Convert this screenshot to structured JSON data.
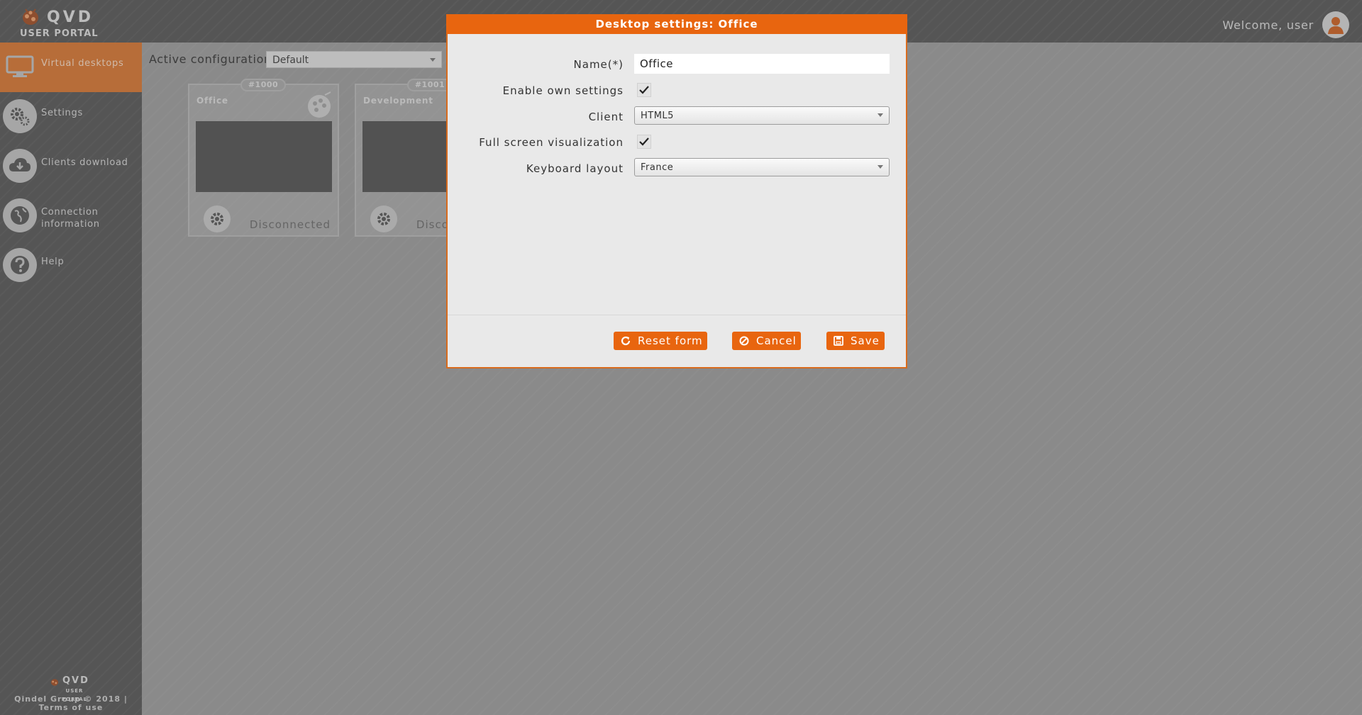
{
  "header": {
    "brand": "QVD",
    "brand_sub": "USER PORTAL",
    "welcome": "Welcome, user"
  },
  "sidebar": {
    "items": [
      {
        "label": "Virtual desktops",
        "icon": "monitor-icon",
        "active": true
      },
      {
        "label": "Settings",
        "icon": "gears-icon",
        "active": false
      },
      {
        "label": "Clients download",
        "icon": "cloud-download-icon",
        "active": false
      },
      {
        "label": "Connection information",
        "icon": "globe-icon",
        "active": false
      },
      {
        "label": "Help",
        "icon": "question-icon",
        "active": false
      }
    ],
    "footer": {
      "brand": "QVD",
      "brand_sub": "USER PORTAL",
      "copyright": "Qindel Group © 2018 | Terms of use"
    }
  },
  "main": {
    "config_label": "Active configuration:",
    "config_value": "Default",
    "desktops": [
      {
        "id": "#1000",
        "name": "Office",
        "state": "Disconnected"
      },
      {
        "id": "#1001",
        "name": "Development",
        "state": "Disconnected"
      }
    ]
  },
  "modal": {
    "title": "Desktop settings: Office",
    "fields": {
      "name_label": "Name(*)",
      "name_value": "Office",
      "own_settings_label": "Enable own settings",
      "own_settings_checked": true,
      "client_label": "Client",
      "client_value": "HTML5",
      "fullscreen_label": "Full screen visualization",
      "fullscreen_checked": true,
      "keyboard_label": "Keyboard layout",
      "keyboard_value": "France"
    },
    "buttons": {
      "reset": "Reset form",
      "cancel": "Cancel",
      "save": "Save"
    }
  },
  "colors": {
    "accent": "#e8650f",
    "sidebar_active": "#d27839",
    "chrome": "#5b5b5b"
  }
}
